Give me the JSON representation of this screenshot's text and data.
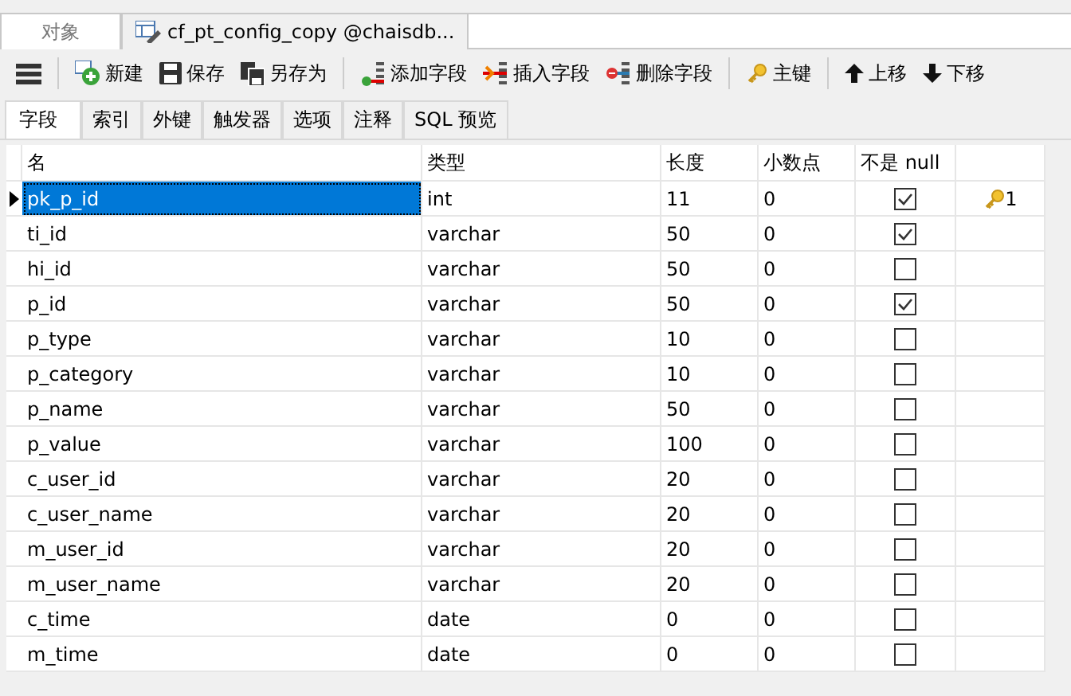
{
  "doc_tabs": [
    {
      "kind": "objects",
      "label": "对象",
      "selected": false
    },
    {
      "kind": "table",
      "label": "cf_pt_config_copy @chaisdb...",
      "selected": true
    }
  ],
  "toolbar": [
    {
      "kind": "menu"
    },
    {
      "kind": "new",
      "label": "新建"
    },
    {
      "kind": "save",
      "label": "保存"
    },
    {
      "kind": "saveas",
      "label": "另存为"
    },
    {
      "kind": "add",
      "label": "添加字段"
    },
    {
      "kind": "insert",
      "label": "插入字段"
    },
    {
      "kind": "delete",
      "label": "删除字段"
    },
    {
      "kind": "key",
      "label": "主键"
    },
    {
      "kind": "up",
      "label": "上移"
    },
    {
      "kind": "down",
      "label": "下移"
    }
  ],
  "sub_tabs": [
    {
      "label": "字段",
      "selected": true
    },
    {
      "label": "索引",
      "selected": false
    },
    {
      "label": "外键",
      "selected": false
    },
    {
      "label": "触发器",
      "selected": false
    },
    {
      "label": "选项",
      "selected": false
    },
    {
      "label": "注释",
      "selected": false
    },
    {
      "label": "SQL 预览",
      "selected": false
    }
  ],
  "table": {
    "columns": [
      "名",
      "类型",
      "长度",
      "小数点",
      "不是 null"
    ],
    "rows": [
      {
        "name": "pk_p_id",
        "type": "int",
        "length": "11",
        "decimal": "0",
        "not_null": true,
        "selected": true,
        "key": "1"
      },
      {
        "name": "ti_id",
        "type": "varchar",
        "length": "50",
        "decimal": "0",
        "not_null": true,
        "selected": false
      },
      {
        "name": "hi_id",
        "type": "varchar",
        "length": "50",
        "decimal": "0",
        "not_null": false,
        "selected": false
      },
      {
        "name": "p_id",
        "type": "varchar",
        "length": "50",
        "decimal": "0",
        "not_null": true,
        "selected": false
      },
      {
        "name": "p_type",
        "type": "varchar",
        "length": "10",
        "decimal": "0",
        "not_null": false,
        "selected": false
      },
      {
        "name": "p_category",
        "type": "varchar",
        "length": "10",
        "decimal": "0",
        "not_null": false,
        "selected": false
      },
      {
        "name": "p_name",
        "type": "varchar",
        "length": "50",
        "decimal": "0",
        "not_null": false,
        "selected": false
      },
      {
        "name": "p_value",
        "type": "varchar",
        "length": "100",
        "decimal": "0",
        "not_null": false,
        "selected": false
      },
      {
        "name": "c_user_id",
        "type": "varchar",
        "length": "20",
        "decimal": "0",
        "not_null": false,
        "selected": false
      },
      {
        "name": "c_user_name",
        "type": "varchar",
        "length": "20",
        "decimal": "0",
        "not_null": false,
        "selected": false
      },
      {
        "name": "m_user_id",
        "type": "varchar",
        "length": "20",
        "decimal": "0",
        "not_null": false,
        "selected": false
      },
      {
        "name": "m_user_name",
        "type": "varchar",
        "length": "20",
        "decimal": "0",
        "not_null": false,
        "selected": false
      },
      {
        "name": "c_time",
        "type": "date",
        "length": "0",
        "decimal": "0",
        "not_null": false,
        "selected": false
      },
      {
        "name": "m_time",
        "type": "date",
        "length": "0",
        "decimal": "0",
        "not_null": false,
        "selected": false
      }
    ]
  }
}
